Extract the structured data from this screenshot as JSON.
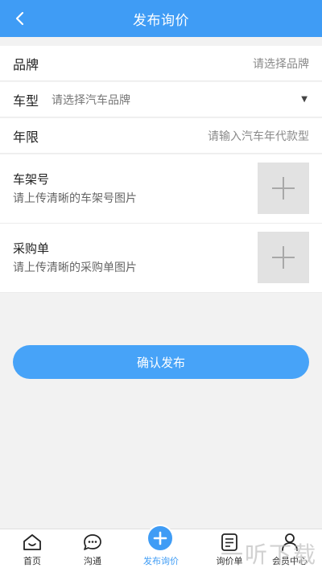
{
  "header": {
    "title": "发布询价"
  },
  "form": {
    "brand": {
      "label": "品牌",
      "placeholder": "请选择品牌"
    },
    "model": {
      "label": "车型",
      "placeholder": "请选择汽车品牌",
      "caret": "▼"
    },
    "year": {
      "label": "年限",
      "placeholder": "请输入汽车年代款型"
    },
    "vin": {
      "title": "车架号",
      "desc": "请上传清晰的车架号图片"
    },
    "purchase": {
      "title": "采购单",
      "desc": "请上传清晰的采购单图片"
    }
  },
  "submit": {
    "label": "确认发布"
  },
  "tabbar": {
    "items": [
      {
        "label": "首页",
        "icon": "home-icon"
      },
      {
        "label": "沟通",
        "icon": "chat-icon"
      },
      {
        "label": "发布询价",
        "icon": "plus-icon",
        "active": true
      },
      {
        "label": "询价单",
        "icon": "document-icon"
      },
      {
        "label": "会员中心",
        "icon": "user-icon"
      }
    ]
  },
  "watermark": "一听下载",
  "colors": {
    "primary": "#3f9cf5",
    "button": "#47a3f8",
    "upload_box": "#e2e2e2"
  }
}
